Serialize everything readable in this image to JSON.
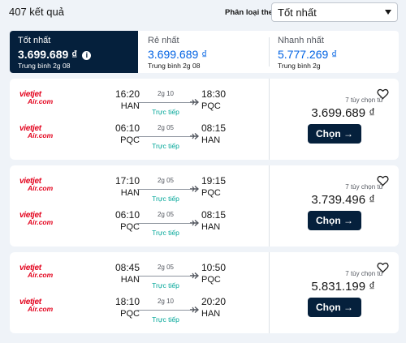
{
  "results": {
    "count_text": "407 kết quả"
  },
  "sort": {
    "label": "Phân loại theo",
    "selected": "Tốt nhất"
  },
  "tabs": [
    {
      "title": "Tốt nhất",
      "price": "3.699.689 ₫",
      "sub": "Trung bình 2g 08",
      "active": true
    },
    {
      "title": "Rẻ nhất",
      "price": "3.699.689 ₫",
      "sub": "Trung bình 2g 08",
      "active": false
    },
    {
      "title": "Nhanh nhất",
      "price": "5.777.269 ₫",
      "sub": "Trung bình 2g",
      "active": false
    }
  ],
  "airline": {
    "line1": "vietjet",
    "line2": "Air.com",
    "brand_color": "#e3001b"
  },
  "cards": [
    {
      "legs": [
        {
          "dep_time": "16:20",
          "dep_code": "HAN",
          "duration": "2g 10",
          "type": "Trực tiếp",
          "arr_time": "18:30",
          "arr_code": "PQC"
        },
        {
          "dep_time": "06:10",
          "dep_code": "PQC",
          "duration": "2g 05",
          "type": "Trực tiếp",
          "arr_time": "08:15",
          "arr_code": "HAN"
        }
      ],
      "deals": "7 tùy chọn từ",
      "price": "3.699.689 ₫",
      "button": "Chọn →"
    },
    {
      "legs": [
        {
          "dep_time": "17:10",
          "dep_code": "HAN",
          "duration": "2g 05",
          "type": "Trực tiếp",
          "arr_time": "19:15",
          "arr_code": "PQC"
        },
        {
          "dep_time": "06:10",
          "dep_code": "PQC",
          "duration": "2g 05",
          "type": "Trực tiếp",
          "arr_time": "08:15",
          "arr_code": "HAN"
        }
      ],
      "deals": "7 tùy chọn từ",
      "price": "3.739.496 ₫",
      "button": "Chọn →"
    },
    {
      "legs": [
        {
          "dep_time": "08:45",
          "dep_code": "HAN",
          "duration": "2g 05",
          "type": "Trực tiếp",
          "arr_time": "10:50",
          "arr_code": "PQC"
        },
        {
          "dep_time": "18:10",
          "dep_code": "PQC",
          "duration": "2g 10",
          "type": "Trực tiếp",
          "arr_time": "20:20",
          "arr_code": "HAN"
        }
      ],
      "deals": "7 tùy chọn từ",
      "price": "5.831.199 ₫",
      "button": "Chọn →"
    }
  ],
  "colors": {
    "accent": "#05203c",
    "link": "#0062e3",
    "direct": "#00a698",
    "background": "#eff3f8"
  },
  "icons": {
    "info": "info-icon",
    "plane": "plane-icon",
    "heart": "heart-icon",
    "chevron": "chevron-down-icon"
  }
}
